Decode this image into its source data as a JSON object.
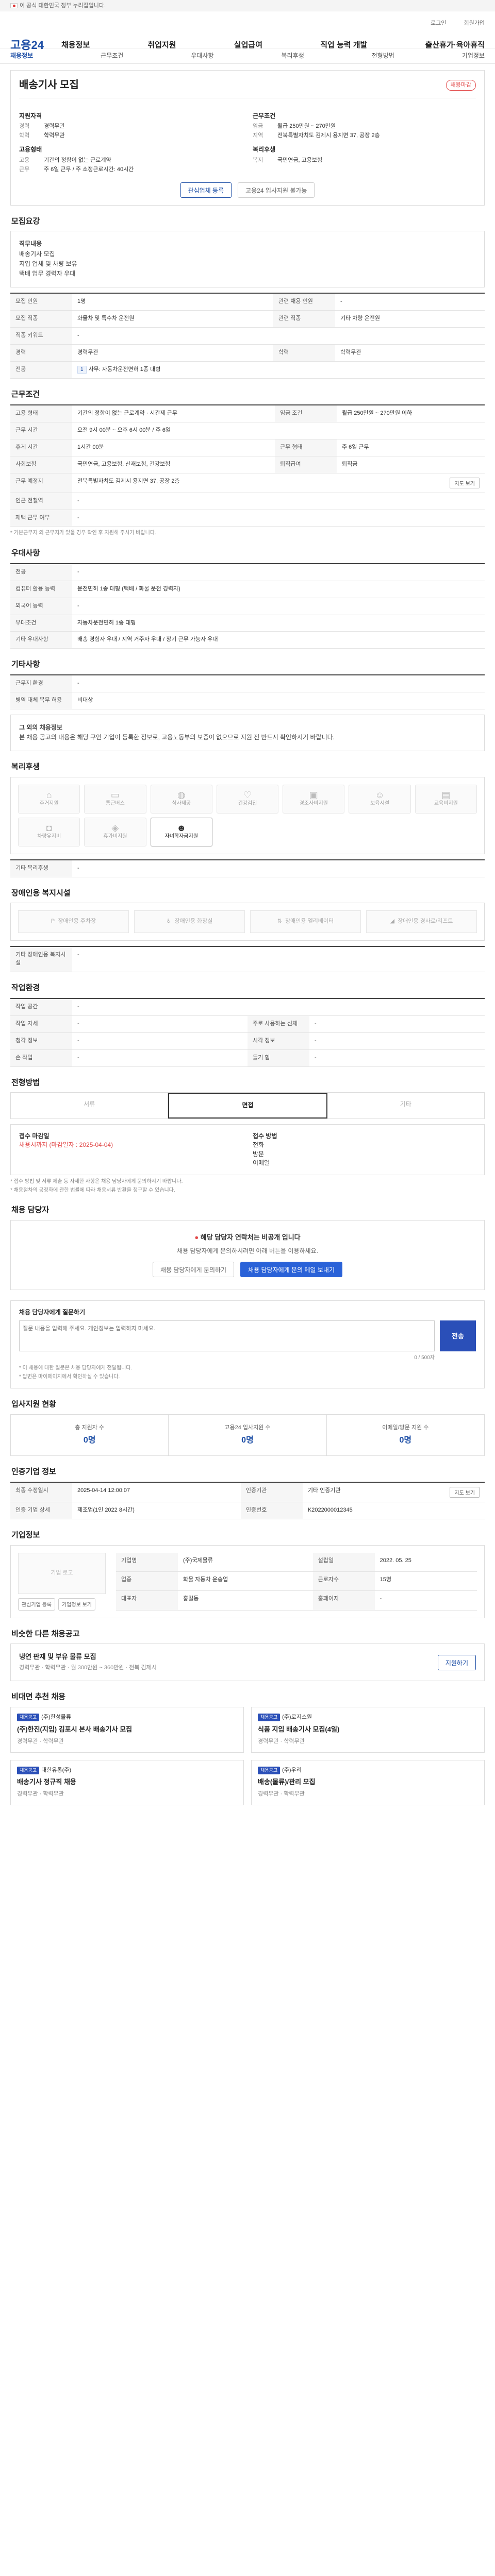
{
  "top": {
    "notice": "이 공식 대한민국 정부 누리집입니다."
  },
  "header": {
    "logo": "고용24",
    "gnb": [
      "채용정보",
      "취업지원",
      "실업급여",
      "직업 능력 개발",
      "출산휴가·육아휴직"
    ],
    "util": [
      "로그인",
      "회원가입"
    ]
  },
  "subnav": [
    "채용정보",
    "근무조건",
    "우대사항",
    "복리후생",
    "전형방법",
    "기업정보"
  ],
  "job": {
    "title": "배송기사 모집",
    "badge": "채용마감",
    "summary_left": {
      "h1": "지원자격",
      "rows1": [
        [
          "경력",
          "경력무관"
        ],
        [
          "학력",
          "학력무관"
        ]
      ],
      "h2": "고용형태",
      "rows2": [
        [
          "고용",
          "기간의 정함이 없는 근로계약"
        ],
        [
          "근무",
          "주 6일 근무 / 주 소정근로시간: 40시간"
        ]
      ]
    },
    "summary_right": {
      "h1": "근무조건",
      "rows1": [
        [
          "임금",
          "월급 250만원 ~ 270만원"
        ],
        [
          "지역",
          "전북특별자치도 김제시 용지면 37, 공장 2층"
        ]
      ],
      "h2": "복리후생",
      "rows2": [
        [
          "복지",
          "국민연금, 고용보험"
        ]
      ]
    },
    "buttons": {
      "apply": "관심업체 등록",
      "share": "고용24 입사지원 불가능"
    }
  },
  "recruit": {
    "title": "모집요강",
    "desc": [
      "직무내용",
      "배송기사 모집",
      "지입 업체 및 차량 보유",
      "택배 업무 경력자 우대"
    ],
    "rows": [
      [
        "모집 인원",
        "1명",
        "관련 채용 인원",
        "-"
      ],
      [
        "모집 직종",
        "화물차 및 특수차 운전원",
        "관련 직종",
        "기타 차량 운전원"
      ],
      [
        "직종 키워드",
        "-",
        "",
        ""
      ],
      [
        "경력",
        "경력무관",
        "학력",
        "학력무관"
      ],
      [
        "전공",
        "사무: 자동차운전면허 1종 대형",
        "",
        ""
      ]
    ]
  },
  "conditions": {
    "title": "근무조건",
    "rows": [
      [
        "고용 형태",
        "기간의 정함이 없는 근로계약 · 시간제 근무",
        "임금 조건",
        "월급 250만원 ~ 270만원 이하"
      ],
      [
        "근무 시간",
        "오전 9시 00분 ~ 오후 6시 00분 / 주 6일",
        "",
        ""
      ],
      [
        "휴게 시간",
        "1시간 00분",
        "근무 형태",
        "주 6일 근무"
      ],
      [
        "사회보험",
        "국민연금, 고용보험, 산재보험, 건강보험",
        "퇴직급여",
        "퇴직금"
      ],
      [
        "근무 예정지",
        "전북특별자치도 김제시 용지면 37, 공장 2층",
        "",
        ""
      ],
      [
        "인근 전철역",
        "-",
        "",
        ""
      ],
      [
        "재택 근무 여부",
        "-",
        "",
        ""
      ]
    ],
    "map_button": "지도 보기",
    "note": "* 기본근무지 외 근무지가 있을 경우 확인 후 지원해 주시기 바랍니다."
  },
  "preferences": {
    "title": "우대사항",
    "rows": [
      [
        "전공",
        "-"
      ],
      [
        "컴퓨터 활용 능력",
        "운전면허 1종 대형 (택배 / 화물 운전 경력자)"
      ],
      [
        "외국어 능력",
        "-"
      ],
      [
        "우대조건",
        "자동차운전면허 1종 대형"
      ],
      [
        "기타 우대사항",
        "배송 경험자 우대 / 지역 거주자 우대 / 장기 근무 가능자 우대"
      ]
    ]
  },
  "other": {
    "title": "기타사항",
    "rows": [
      [
        "근무지 환경",
        "-"
      ],
      [
        "병역 대체 복무 허용",
        "비대상"
      ]
    ],
    "notice_title": "그 외의 채용정보",
    "notice": "본 채용 공고의 내용은 해당 구인 기업이 등록한 정보로, 고용노동부의 보증이 없으므로 지원 전 반드시 확인하시기 바랍니다."
  },
  "welfare": {
    "title": "복리후생",
    "items": [
      {
        "icon": "house-icon",
        "label": "주거지원",
        "on": false
      },
      {
        "icon": "bus-icon",
        "label": "통근버스",
        "on": false
      },
      {
        "icon": "meal-icon",
        "label": "식사제공",
        "on": false
      },
      {
        "icon": "heart-icon",
        "label": "건강검진",
        "on": false
      },
      {
        "icon": "gift-icon",
        "label": "경조사비지원",
        "on": false
      },
      {
        "icon": "child-icon",
        "label": "보육시설",
        "on": false
      },
      {
        "icon": "book-icon",
        "label": "교육비지원",
        "on": false
      },
      {
        "icon": "car-icon",
        "label": "차량유지비",
        "on": false
      },
      {
        "icon": "cake-icon",
        "label": "휴가비지원",
        "on": false
      },
      {
        "icon": "family-icon",
        "label": "자녀학자금지원",
        "on": true
      }
    ],
    "other_label": "기타 복리후생",
    "other_value": "-"
  },
  "disability": {
    "title": "장애인용 복지시설",
    "items": [
      "장애인용 주차장",
      "장애인용 화장실",
      "장애인용 엘리베이터",
      "장애인용 경사로/리프트"
    ],
    "other_label": "기타 장애인용 복지시설",
    "other_value": "-"
  },
  "work_env": {
    "title": "작업환경",
    "rows": [
      [
        "작업 공간",
        "-",
        "",
        ""
      ],
      [
        "작업 자세",
        "-",
        "주로 사용하는 신체",
        "-"
      ],
      [
        "청각 정보",
        "-",
        "시각 정보",
        "-"
      ],
      [
        "손 작업",
        "-",
        "들기 힘",
        "-"
      ]
    ]
  },
  "method": {
    "title": "전형방법",
    "tabs": [
      "서류",
      "면접",
      "기타"
    ],
    "left_title": "접수 마감일",
    "left_value": "채용시까지 (마감일자 : 2025-04-04)",
    "right_title": "접수 방법",
    "right_items": [
      "전화",
      "방문",
      "이메일"
    ],
    "notes": [
      "* 접수 방법 및 서류 제출 등 자세한 사항은 채용 담당자에게 문의하시기 바랍니다.",
      "* 채용절차의 공정화에 관한 법률에 따라 채용서류 반환을 청구할 수 있습니다."
    ]
  },
  "contact": {
    "title": "채용 담당자",
    "headline": "해당 담당자 연락처는 비공개 입니다",
    "desc": "채용 담당자에게 문의하시려면 아래 버튼을 이용하세요.",
    "btn1": "채용 담당자에게 문의하기",
    "btn2": "채용 담당자에게 문의 메일 보내기"
  },
  "question": {
    "title": "채용 담당자에게 질문하기",
    "placeholder": "질문 내용을 입력해 주세요. 개인정보는 입력하지 마세요.",
    "send": "전송",
    "counter": "0 / 500자",
    "notes": [
      "* 이 채용에 대한 질문은 채용 담당자에게 전달됩니다.",
      "* 답변은 마이페이지에서 확인하실 수 있습니다."
    ]
  },
  "stats": {
    "title": "입사지원 현황",
    "items": [
      {
        "label": "총 지원자 수",
        "value": "0명"
      },
      {
        "label": "고용24 입사지원 수",
        "value": "0명"
      },
      {
        "label": "이메일/방문 지원 수",
        "value": "0명"
      }
    ]
  },
  "info": {
    "title": "인증기업 정보",
    "rows": [
      [
        "최종 수정일시",
        "2025-04-14 12:00:07",
        "인증기관",
        "기타 인증기관"
      ],
      [
        "인증 기업 상세",
        "제조업(1인 2022 8시간)",
        "인증번호",
        "K2022000012345"
      ]
    ],
    "button": "지도 보기"
  },
  "company": {
    "title": "기업정보",
    "logo_text": "기업 로고",
    "rows": [
      [
        "기업명",
        "(주)국제물류"
      ],
      [
        "업종",
        "화물 자동차 운송업"
      ],
      [
        "대표자",
        "홍길동"
      ],
      [
        "설립일",
        "2022. 05. 25"
      ],
      [
        "근로자수",
        "15명"
      ],
      [
        "홈페이지",
        "-"
      ]
    ],
    "buttons": [
      "관심기업 등록",
      "기업정보 보기"
    ]
  },
  "similar": {
    "title": "비슷한 다른 채용공고",
    "card_title": "냉연 판재 및 부유 물류 모집",
    "card_meta": [
      "경력무관",
      "학력무관",
      "월 300만원 ~ 360만원",
      "전북 김제시"
    ],
    "card_button": "지원하기"
  },
  "related": {
    "title": "비대면 추천 채용",
    "jobs": [
      {
        "label": "채용공고",
        "org": "(주)한성물류",
        "title": "(주)한진(지입) 김포시 본사 배송기사 모집",
        "meta": "경력무관 · 학력무관"
      },
      {
        "label": "채용공고",
        "org": "(주)로지스원",
        "title": "식품 지입 배송기사 모집(4일)",
        "meta": "경력무관 · 학력무관"
      },
      {
        "label": "채용공고",
        "org": "대한유통(주)",
        "title": "배송기사 정규직 채용",
        "meta": "경력무관 · 학력무관"
      },
      {
        "label": "채용공고",
        "org": "(주)우리",
        "title": "배송(물류)/관리 모집",
        "meta": "경력무관 · 학력무관"
      }
    ]
  }
}
